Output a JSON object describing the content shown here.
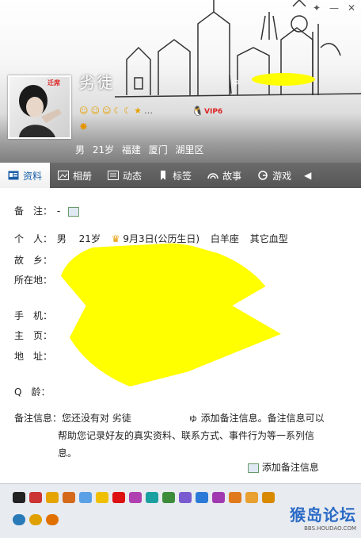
{
  "profile": {
    "nickname": "劣徒",
    "nick_mark": "ゅ",
    "avatar_badge": "迁席",
    "vip_label": "VIP6",
    "basic_info": "男 21岁 福建 厦门 湖里区"
  },
  "status_icons": [
    "smile-icon",
    "smile-icon",
    "smile-icon",
    "moon-icon",
    "moon-icon",
    "star-icon"
  ],
  "window_buttons": {
    "skin": "skin-icon",
    "min": "—",
    "close": "✕"
  },
  "tabs": [
    {
      "label": "资料",
      "icon": "profile-card-icon",
      "active": true
    },
    {
      "label": "相册",
      "icon": "photo-album-icon",
      "active": false
    },
    {
      "label": "动态",
      "icon": "feed-icon",
      "active": false
    },
    {
      "label": "标签",
      "icon": "bookmark-icon",
      "active": false
    },
    {
      "label": "故事",
      "icon": "story-icon",
      "active": false
    },
    {
      "label": "游戏",
      "icon": "game-icon",
      "active": false
    }
  ],
  "info": {
    "remark_label": "备　注：",
    "remark_value": "-",
    "personal_label": "个　人：",
    "personal_gender": "男",
    "personal_age": "21岁",
    "personal_birthday": "9月3日(公历生日)",
    "personal_zodiac": "白羊座",
    "personal_blood": "其它血型",
    "hometown_label": "故　乡：",
    "location_label": "所在地：",
    "phone_label": "手　机：",
    "homepage_label": "主　页：",
    "address_label": "地　址：",
    "qage_label": "Q　龄："
  },
  "note": {
    "label": "备注信息：",
    "text_line1": "您还没有对 劣徒　　　　　　ゅ 添加备注信息。备注信息可以",
    "text_line2": "帮助您记录好友的真实资料、联系方式、事件行为等一系列信",
    "text_line3": "息。"
  },
  "add_note_label": "添加备注信息",
  "watermark": {
    "main": "猴岛论坛",
    "sub": "BBS.HOUDAO.COM"
  }
}
